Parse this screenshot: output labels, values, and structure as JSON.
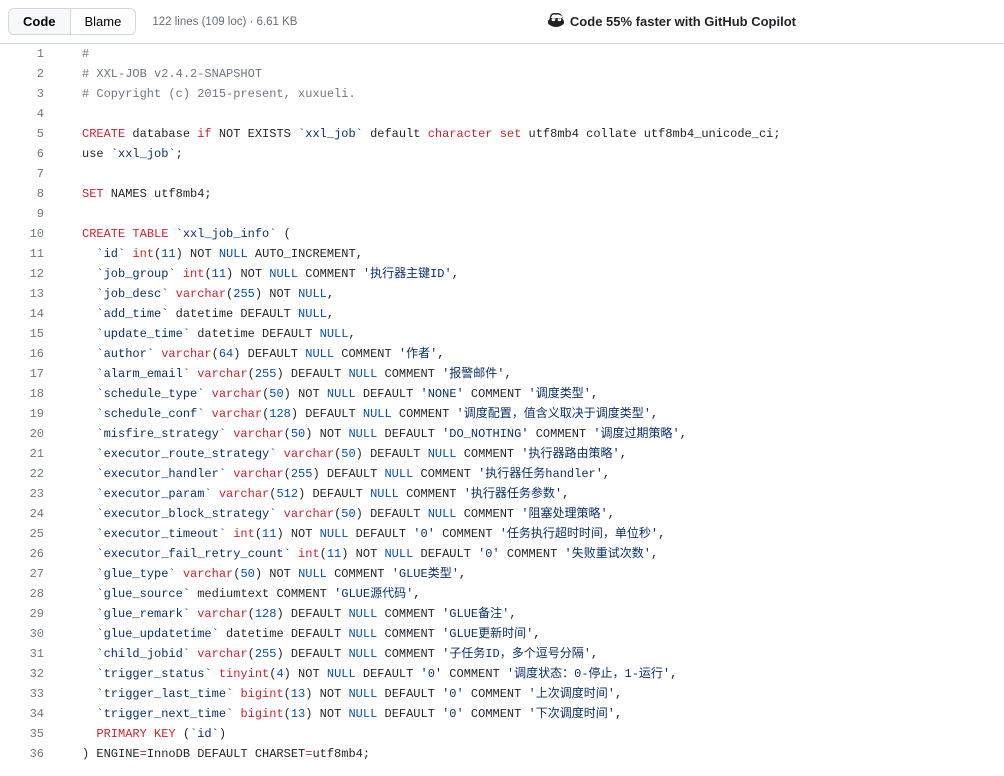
{
  "toolbar": {
    "code_label": "Code",
    "blame_label": "Blame",
    "meta": "122 lines (109 loc) · 6.61 KB",
    "copilot_label": "Code 55% faster with GitHub Copilot"
  },
  "code_lines": [
    {
      "n": 1,
      "tokens": [
        [
          "#",
          "pl-c"
        ]
      ]
    },
    {
      "n": 2,
      "tokens": [
        [
          "# XXL-JOB v2.4.2-SNAPSHOT",
          "pl-c"
        ]
      ]
    },
    {
      "n": 3,
      "tokens": [
        [
          "# Copyright (c) 2015-present, xuxueli.",
          "pl-c"
        ]
      ]
    },
    {
      "n": 4,
      "tokens": []
    },
    {
      "n": 5,
      "tokens": [
        [
          "CREATE",
          "pl-k"
        ],
        [
          " database "
        ],
        [
          "if",
          "pl-k"
        ],
        [
          " NOT EXISTS "
        ],
        [
          "`xxl_job`",
          "pl-s"
        ],
        [
          " default "
        ],
        [
          "character",
          "pl-k"
        ],
        [
          " "
        ],
        [
          "set",
          "pl-k"
        ],
        [
          " utf8mb4 collate utf8mb4_unicode_ci;"
        ]
      ]
    },
    {
      "n": 6,
      "tokens": [
        [
          "use "
        ],
        [
          "`xxl_job`",
          "pl-s"
        ],
        [
          ";"
        ]
      ]
    },
    {
      "n": 7,
      "tokens": []
    },
    {
      "n": 8,
      "tokens": [
        [
          "SET",
          "pl-k"
        ],
        [
          " NAMES utf8mb4;"
        ]
      ]
    },
    {
      "n": 9,
      "tokens": []
    },
    {
      "n": 10,
      "tokens": [
        [
          "CREATE",
          "pl-k"
        ],
        [
          " "
        ],
        [
          "TABLE",
          "pl-k"
        ],
        [
          " "
        ],
        [
          "`xxl_job_info`",
          "pl-s"
        ],
        [
          " ("
        ]
      ]
    },
    {
      "n": 11,
      "tokens": [
        [
          "  "
        ],
        [
          "`id`",
          "pl-s"
        ],
        [
          " "
        ],
        [
          "int",
          "pl-k"
        ],
        [
          "("
        ],
        [
          "11",
          "pl-c1"
        ],
        [
          ") NOT "
        ],
        [
          "NULL",
          "pl-c1"
        ],
        [
          " AUTO_INCREMENT,"
        ]
      ]
    },
    {
      "n": 12,
      "tokens": [
        [
          "  "
        ],
        [
          "`job_group`",
          "pl-s"
        ],
        [
          " "
        ],
        [
          "int",
          "pl-k"
        ],
        [
          "("
        ],
        [
          "11",
          "pl-c1"
        ],
        [
          ") NOT "
        ],
        [
          "NULL",
          "pl-c1"
        ],
        [
          " COMMENT "
        ],
        [
          "'执行器主键ID'",
          "pl-s"
        ],
        [
          ","
        ]
      ]
    },
    {
      "n": 13,
      "tokens": [
        [
          "  "
        ],
        [
          "`job_desc`",
          "pl-s"
        ],
        [
          " "
        ],
        [
          "varchar",
          "pl-k"
        ],
        [
          "("
        ],
        [
          "255",
          "pl-c1"
        ],
        [
          ") NOT "
        ],
        [
          "NULL",
          "pl-c1"
        ],
        [
          ","
        ]
      ]
    },
    {
      "n": 14,
      "tokens": [
        [
          "  "
        ],
        [
          "`add_time`",
          "pl-s"
        ],
        [
          " datetime DEFAULT "
        ],
        [
          "NULL",
          "pl-c1"
        ],
        [
          ","
        ]
      ]
    },
    {
      "n": 15,
      "tokens": [
        [
          "  "
        ],
        [
          "`update_time`",
          "pl-s"
        ],
        [
          " datetime DEFAULT "
        ],
        [
          "NULL",
          "pl-c1"
        ],
        [
          ","
        ]
      ]
    },
    {
      "n": 16,
      "tokens": [
        [
          "  "
        ],
        [
          "`author`",
          "pl-s"
        ],
        [
          " "
        ],
        [
          "varchar",
          "pl-k"
        ],
        [
          "("
        ],
        [
          "64",
          "pl-c1"
        ],
        [
          ") DEFAULT "
        ],
        [
          "NULL",
          "pl-c1"
        ],
        [
          " COMMENT "
        ],
        [
          "'作者'",
          "pl-s"
        ],
        [
          ","
        ]
      ]
    },
    {
      "n": 17,
      "tokens": [
        [
          "  "
        ],
        [
          "`alarm_email`",
          "pl-s"
        ],
        [
          " "
        ],
        [
          "varchar",
          "pl-k"
        ],
        [
          "("
        ],
        [
          "255",
          "pl-c1"
        ],
        [
          ") DEFAULT "
        ],
        [
          "NULL",
          "pl-c1"
        ],
        [
          " COMMENT "
        ],
        [
          "'报警邮件'",
          "pl-s"
        ],
        [
          ","
        ]
      ]
    },
    {
      "n": 18,
      "tokens": [
        [
          "  "
        ],
        [
          "`schedule_type`",
          "pl-s"
        ],
        [
          " "
        ],
        [
          "varchar",
          "pl-k"
        ],
        [
          "("
        ],
        [
          "50",
          "pl-c1"
        ],
        [
          ") NOT "
        ],
        [
          "NULL",
          "pl-c1"
        ],
        [
          " DEFAULT "
        ],
        [
          "'NONE'",
          "pl-s"
        ],
        [
          " COMMENT "
        ],
        [
          "'调度类型'",
          "pl-s"
        ],
        [
          ","
        ]
      ]
    },
    {
      "n": 19,
      "tokens": [
        [
          "  "
        ],
        [
          "`schedule_conf`",
          "pl-s"
        ],
        [
          " "
        ],
        [
          "varchar",
          "pl-k"
        ],
        [
          "("
        ],
        [
          "128",
          "pl-c1"
        ],
        [
          ") DEFAULT "
        ],
        [
          "NULL",
          "pl-c1"
        ],
        [
          " COMMENT "
        ],
        [
          "'调度配置，值含义取决于调度类型'",
          "pl-s"
        ],
        [
          ","
        ]
      ]
    },
    {
      "n": 20,
      "tokens": [
        [
          "  "
        ],
        [
          "`misfire_strategy`",
          "pl-s"
        ],
        [
          " "
        ],
        [
          "varchar",
          "pl-k"
        ],
        [
          "("
        ],
        [
          "50",
          "pl-c1"
        ],
        [
          ") NOT "
        ],
        [
          "NULL",
          "pl-c1"
        ],
        [
          " DEFAULT "
        ],
        [
          "'DO_NOTHING'",
          "pl-s"
        ],
        [
          " COMMENT "
        ],
        [
          "'调度过期策略'",
          "pl-s"
        ],
        [
          ","
        ]
      ]
    },
    {
      "n": 21,
      "tokens": [
        [
          "  "
        ],
        [
          "`executor_route_strategy`",
          "pl-s"
        ],
        [
          " "
        ],
        [
          "varchar",
          "pl-k"
        ],
        [
          "("
        ],
        [
          "50",
          "pl-c1"
        ],
        [
          ") DEFAULT "
        ],
        [
          "NULL",
          "pl-c1"
        ],
        [
          " COMMENT "
        ],
        [
          "'执行器路由策略'",
          "pl-s"
        ],
        [
          ","
        ]
      ]
    },
    {
      "n": 22,
      "tokens": [
        [
          "  "
        ],
        [
          "`executor_handler`",
          "pl-s"
        ],
        [
          " "
        ],
        [
          "varchar",
          "pl-k"
        ],
        [
          "("
        ],
        [
          "255",
          "pl-c1"
        ],
        [
          ") DEFAULT "
        ],
        [
          "NULL",
          "pl-c1"
        ],
        [
          " COMMENT "
        ],
        [
          "'执行器任务handler'",
          "pl-s"
        ],
        [
          ","
        ]
      ]
    },
    {
      "n": 23,
      "tokens": [
        [
          "  "
        ],
        [
          "`executor_param`",
          "pl-s"
        ],
        [
          " "
        ],
        [
          "varchar",
          "pl-k"
        ],
        [
          "("
        ],
        [
          "512",
          "pl-c1"
        ],
        [
          ") DEFAULT "
        ],
        [
          "NULL",
          "pl-c1"
        ],
        [
          " COMMENT "
        ],
        [
          "'执行器任务参数'",
          "pl-s"
        ],
        [
          ","
        ]
      ]
    },
    {
      "n": 24,
      "tokens": [
        [
          "  "
        ],
        [
          "`executor_block_strategy`",
          "pl-s"
        ],
        [
          " "
        ],
        [
          "varchar",
          "pl-k"
        ],
        [
          "("
        ],
        [
          "50",
          "pl-c1"
        ],
        [
          ") DEFAULT "
        ],
        [
          "NULL",
          "pl-c1"
        ],
        [
          " COMMENT "
        ],
        [
          "'阻塞处理策略'",
          "pl-s"
        ],
        [
          ","
        ]
      ]
    },
    {
      "n": 25,
      "tokens": [
        [
          "  "
        ],
        [
          "`executor_timeout`",
          "pl-s"
        ],
        [
          " "
        ],
        [
          "int",
          "pl-k"
        ],
        [
          "("
        ],
        [
          "11",
          "pl-c1"
        ],
        [
          ") NOT "
        ],
        [
          "NULL",
          "pl-c1"
        ],
        [
          " DEFAULT "
        ],
        [
          "'0'",
          "pl-s"
        ],
        [
          " COMMENT "
        ],
        [
          "'任务执行超时时间，单位秒'",
          "pl-s"
        ],
        [
          ","
        ]
      ]
    },
    {
      "n": 26,
      "tokens": [
        [
          "  "
        ],
        [
          "`executor_fail_retry_count`",
          "pl-s"
        ],
        [
          " "
        ],
        [
          "int",
          "pl-k"
        ],
        [
          "("
        ],
        [
          "11",
          "pl-c1"
        ],
        [
          ") NOT "
        ],
        [
          "NULL",
          "pl-c1"
        ],
        [
          " DEFAULT "
        ],
        [
          "'0'",
          "pl-s"
        ],
        [
          " COMMENT "
        ],
        [
          "'失败重试次数'",
          "pl-s"
        ],
        [
          ","
        ]
      ]
    },
    {
      "n": 27,
      "tokens": [
        [
          "  "
        ],
        [
          "`glue_type`",
          "pl-s"
        ],
        [
          " "
        ],
        [
          "varchar",
          "pl-k"
        ],
        [
          "("
        ],
        [
          "50",
          "pl-c1"
        ],
        [
          ") NOT "
        ],
        [
          "NULL",
          "pl-c1"
        ],
        [
          " COMMENT "
        ],
        [
          "'GLUE类型'",
          "pl-s"
        ],
        [
          ","
        ]
      ]
    },
    {
      "n": 28,
      "tokens": [
        [
          "  "
        ],
        [
          "`glue_source`",
          "pl-s"
        ],
        [
          " mediumtext COMMENT "
        ],
        [
          "'GLUE源代码'",
          "pl-s"
        ],
        [
          ","
        ]
      ]
    },
    {
      "n": 29,
      "tokens": [
        [
          "  "
        ],
        [
          "`glue_remark`",
          "pl-s"
        ],
        [
          " "
        ],
        [
          "varchar",
          "pl-k"
        ],
        [
          "("
        ],
        [
          "128",
          "pl-c1"
        ],
        [
          ") DEFAULT "
        ],
        [
          "NULL",
          "pl-c1"
        ],
        [
          " COMMENT "
        ],
        [
          "'GLUE备注'",
          "pl-s"
        ],
        [
          ","
        ]
      ]
    },
    {
      "n": 30,
      "tokens": [
        [
          "  "
        ],
        [
          "`glue_updatetime`",
          "pl-s"
        ],
        [
          " datetime DEFAULT "
        ],
        [
          "NULL",
          "pl-c1"
        ],
        [
          " COMMENT "
        ],
        [
          "'GLUE更新时间'",
          "pl-s"
        ],
        [
          ","
        ]
      ]
    },
    {
      "n": 31,
      "tokens": [
        [
          "  "
        ],
        [
          "`child_jobid`",
          "pl-s"
        ],
        [
          " "
        ],
        [
          "varchar",
          "pl-k"
        ],
        [
          "("
        ],
        [
          "255",
          "pl-c1"
        ],
        [
          ") DEFAULT "
        ],
        [
          "NULL",
          "pl-c1"
        ],
        [
          " COMMENT "
        ],
        [
          "'子任务ID，多个逗号分隔'",
          "pl-s"
        ],
        [
          ","
        ]
      ]
    },
    {
      "n": 32,
      "tokens": [
        [
          "  "
        ],
        [
          "`trigger_status`",
          "pl-s"
        ],
        [
          " "
        ],
        [
          "tinyint",
          "pl-k"
        ],
        [
          "("
        ],
        [
          "4",
          "pl-c1"
        ],
        [
          ") NOT "
        ],
        [
          "NULL",
          "pl-c1"
        ],
        [
          " DEFAULT "
        ],
        [
          "'0'",
          "pl-s"
        ],
        [
          " COMMENT "
        ],
        [
          "'调度状态：0-停止，1-运行'",
          "pl-s"
        ],
        [
          ","
        ]
      ]
    },
    {
      "n": 33,
      "tokens": [
        [
          "  "
        ],
        [
          "`trigger_last_time`",
          "pl-s"
        ],
        [
          " "
        ],
        [
          "bigint",
          "pl-k"
        ],
        [
          "("
        ],
        [
          "13",
          "pl-c1"
        ],
        [
          ") NOT "
        ],
        [
          "NULL",
          "pl-c1"
        ],
        [
          " DEFAULT "
        ],
        [
          "'0'",
          "pl-s"
        ],
        [
          " COMMENT "
        ],
        [
          "'上次调度时间'",
          "pl-s"
        ],
        [
          ","
        ]
      ]
    },
    {
      "n": 34,
      "tokens": [
        [
          "  "
        ],
        [
          "`trigger_next_time`",
          "pl-s"
        ],
        [
          " "
        ],
        [
          "bigint",
          "pl-k"
        ],
        [
          "("
        ],
        [
          "13",
          "pl-c1"
        ],
        [
          ") NOT "
        ],
        [
          "NULL",
          "pl-c1"
        ],
        [
          " DEFAULT "
        ],
        [
          "'0'",
          "pl-s"
        ],
        [
          " COMMENT "
        ],
        [
          "'下次调度时间'",
          "pl-s"
        ],
        [
          ","
        ]
      ]
    },
    {
      "n": 35,
      "tokens": [
        [
          "  "
        ],
        [
          "PRIMARY KEY",
          "pl-k"
        ],
        [
          " ("
        ],
        [
          "`id`",
          "pl-s"
        ],
        [
          ")"
        ]
      ]
    },
    {
      "n": 36,
      "tokens": [
        [
          ") ENGINE"
        ],
        [
          "=",
          "pl-k"
        ],
        [
          "InnoDB DEFAULT CHARSET"
        ],
        [
          "=",
          "pl-k"
        ],
        [
          "utf8mb4;"
        ]
      ]
    }
  ]
}
